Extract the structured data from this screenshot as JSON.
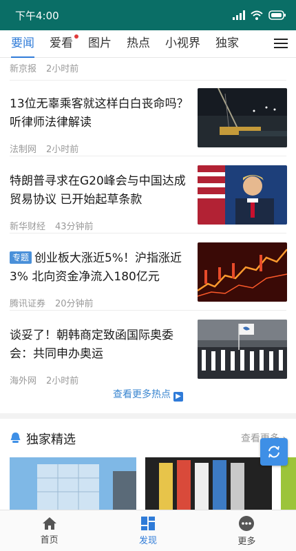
{
  "status": {
    "time": "下午4:00"
  },
  "tabs": [
    {
      "label": "要闻",
      "active": true
    },
    {
      "label": "爱看",
      "has_dot": true
    },
    {
      "label": "图片"
    },
    {
      "label": "热点"
    },
    {
      "label": "小视界"
    },
    {
      "label": "独家"
    }
  ],
  "feed": {
    "top_partial": {
      "source": "新京报",
      "time": "2小时前"
    },
    "items": [
      {
        "title": "13位无辜乘客就这样白白丧命吗？听律师法律解读",
        "source": "法制网",
        "time": "2小时前",
        "thumb": "night-crane-scene"
      },
      {
        "title": "特朗普寻求在G20峰会与中国达成贸易协议 已开始起草条款",
        "source": "新华财经",
        "time": "43分钟前",
        "thumb": "speaker-with-flag"
      },
      {
        "badge": "专题",
        "title": "创业板大涨近5%！沪指涨近3% 北向资金净流入180亿元",
        "source": "腾讯证券",
        "time": "20分钟前",
        "thumb": "stock-chart"
      },
      {
        "title": "谈妥了！朝韩商定致函国际奥委会：共同申办奥运",
        "source": "海外网",
        "time": "2小时前",
        "thumb": "parade-flags"
      }
    ],
    "more_hot_label": "查看更多热点"
  },
  "exclusive": {
    "title": "独家精选",
    "more_label": "查看更多",
    "cards": [
      "glass-building",
      "credit-cards",
      "green-partial"
    ]
  },
  "bottom_nav": [
    {
      "label": "首页",
      "icon": "home-icon"
    },
    {
      "label": "发现",
      "icon": "grid-icon",
      "active": true
    },
    {
      "label": "更多",
      "icon": "more-dots-icon"
    }
  ],
  "colors": {
    "status_bar": "#0a6e66",
    "accent": "#2f7bd8",
    "badge": "#4a90d9",
    "refresh": "#3e8fe6"
  }
}
